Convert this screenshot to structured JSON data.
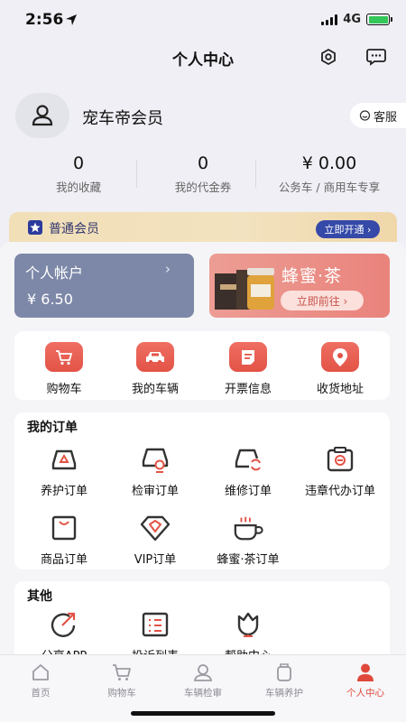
{
  "status_bar": {
    "time": "2:56",
    "network": "4G"
  },
  "header": {
    "title": "个人中心"
  },
  "profile": {
    "name": "宠车帝会员",
    "service_label": "客服"
  },
  "stats": [
    {
      "value": "0",
      "label": "我的收藏"
    },
    {
      "value": "0",
      "label": "我的代金券"
    },
    {
      "value": "¥ 0.00",
      "label": "公务车 / 商用车专享"
    }
  ],
  "membership": {
    "level": "普通会员",
    "action": "立即开通 ›"
  },
  "account": {
    "title": "个人帐户",
    "arrow": "›",
    "balance": "¥ 6.50"
  },
  "promo": {
    "title": "蜂蜜·茶",
    "button": "立即前往 ›"
  },
  "quick_links": [
    {
      "label": "购物车",
      "icon": "cart-icon"
    },
    {
      "label": "我的车辆",
      "icon": "car-icon"
    },
    {
      "label": "开票信息",
      "icon": "invoice-icon"
    },
    {
      "label": "收货地址",
      "icon": "location-icon"
    }
  ],
  "orders": {
    "title": "我的订单",
    "items": [
      {
        "label": "养护订单",
        "icon": "maintenance-order-icon"
      },
      {
        "label": "检审订单",
        "icon": "inspection-order-icon"
      },
      {
        "label": "维修订单",
        "icon": "repair-order-icon"
      },
      {
        "label": "违章代办订单",
        "icon": "violation-order-icon"
      },
      {
        "label": "商品订单",
        "icon": "shopping-bag-icon"
      },
      {
        "label": "VIP订单",
        "icon": "diamond-icon"
      },
      {
        "label": "蜂蜜·茶订单",
        "icon": "tea-cup-icon"
      }
    ]
  },
  "other": {
    "title": "其他",
    "items": [
      {
        "label": "分享APP",
        "icon": "share-icon"
      },
      {
        "label": "投诉列表",
        "icon": "complaint-list-icon"
      },
      {
        "label": "帮助中心",
        "icon": "help-icon"
      }
    ]
  },
  "tabs": [
    {
      "label": "首页",
      "icon": "home-icon",
      "active": false
    },
    {
      "label": "购物车",
      "icon": "cart-icon",
      "active": false
    },
    {
      "label": "车辆检审",
      "icon": "inspection-icon",
      "active": false
    },
    {
      "label": "车辆养护",
      "icon": "maintenance-icon",
      "active": false
    },
    {
      "label": "个人中心",
      "icon": "person-icon",
      "active": true
    }
  ],
  "colors": {
    "accent": "#e0483c",
    "member_blue": "#3549a8",
    "account_card": "#7d88a8",
    "promo_card": "#e9837c"
  }
}
